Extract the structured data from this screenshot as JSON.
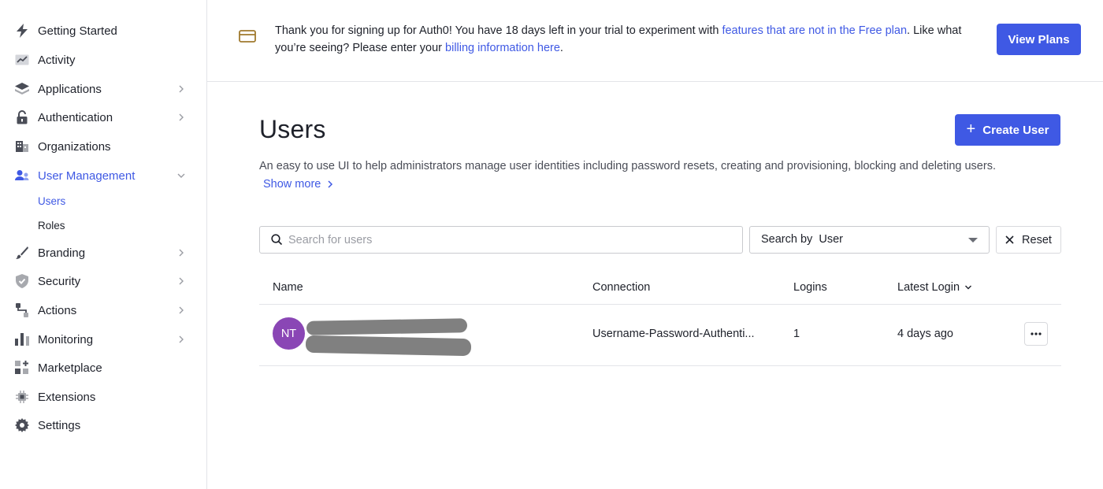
{
  "colors": {
    "accent": "#3f59e4",
    "avatar_bg": "#8a46b5",
    "border": "#e3e4e8",
    "text": "#1e212a"
  },
  "sidebar": {
    "items": [
      {
        "label": "Getting Started",
        "icon": "lightning-icon"
      },
      {
        "label": "Activity",
        "icon": "activity-chart-icon"
      },
      {
        "label": "Applications",
        "icon": "layers-icon"
      },
      {
        "label": "Authentication",
        "icon": "lock-icon"
      },
      {
        "label": "Organizations",
        "icon": "building-icon"
      },
      {
        "label": "User Management",
        "icon": "users-icon"
      },
      {
        "label": "Branding",
        "icon": "brush-icon"
      },
      {
        "label": "Security",
        "icon": "shield-check-icon"
      },
      {
        "label": "Actions",
        "icon": "flow-icon"
      },
      {
        "label": "Monitoring",
        "icon": "bar-chart-icon"
      },
      {
        "label": "Marketplace",
        "icon": "grid-plus-icon"
      },
      {
        "label": "Extensions",
        "icon": "chip-icon"
      },
      {
        "label": "Settings",
        "icon": "gear-icon"
      }
    ],
    "sub_items": [
      {
        "label": "Users"
      },
      {
        "label": "Roles"
      }
    ]
  },
  "banner": {
    "text_1": "Thank you for signing up for Auth0! You have 18 days left in your trial to experiment with ",
    "link_1": "features that are not in the Free plan",
    "text_2": ". Like what you’re seeing? Please enter your ",
    "link_2": "billing information here",
    "text_3": ".",
    "button_label": "View Plans"
  },
  "main": {
    "title": "Users",
    "create_button_label": "Create User",
    "description": "An easy to use UI to help administrators manage user identities including password resets, creating and provisioning, blocking and deleting users.",
    "show_more_label": "Show more",
    "search": {
      "placeholder": "Search for users",
      "search_by_label": "Search by",
      "search_by_value": "User",
      "reset_label": "Reset"
    },
    "table": {
      "columns": [
        "Name",
        "Connection",
        "Logins",
        "Latest Login"
      ],
      "rows": [
        {
          "initials": "NT",
          "connection": "Username-Password-Authenti...",
          "logins": "1",
          "latest_login": "4 days ago"
        }
      ]
    }
  }
}
